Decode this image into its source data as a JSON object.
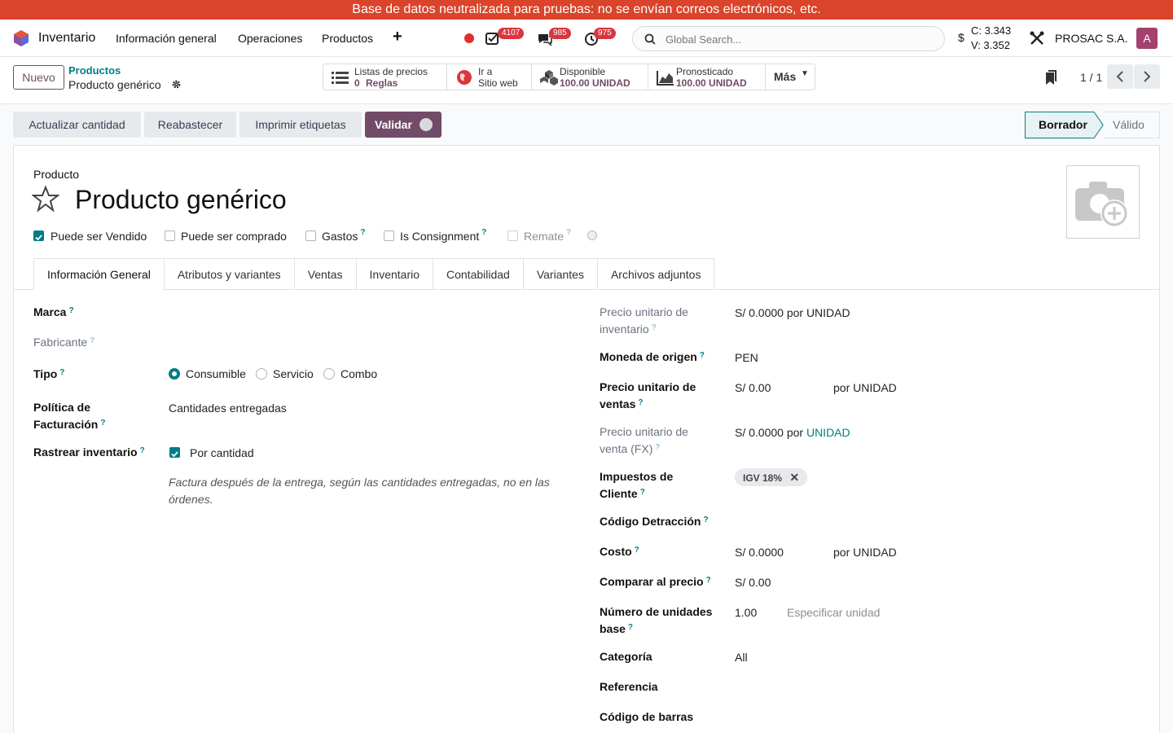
{
  "banner": "Base de datos neutralizada para pruebas: no se envían correos electrónicos, etc.",
  "navbar": {
    "app_name": "Inventario",
    "menu": [
      "Información general",
      "Operaciones",
      "Productos"
    ],
    "badges": {
      "activities": "4107",
      "messages": "985",
      "timers": "975"
    },
    "search_placeholder": "Global Search...",
    "currency_symbol": "$",
    "rate_buy": "C: 3.343",
    "rate_sell": "V: 3.352",
    "company": "PROSAC S.A.",
    "avatar_letter": "A",
    "avatar_color": "#a2426d"
  },
  "control": {
    "new_label": "Nuevo",
    "breadcrumb_parent": "Productos",
    "breadcrumb_current": "Producto genérico",
    "smart_buttons": {
      "pricelists_title": "Listas de precios",
      "pricelists_count": "0",
      "pricelists_unit": "Reglas",
      "website_line1": "Ir a",
      "website_line2": "Sitio web",
      "available_title": "Disponible",
      "available_value": "100.00 UNIDAD",
      "forecast_title": "Pronosticado",
      "forecast_value": "100.00 UNIDAD",
      "more_label": "Más"
    },
    "pager": "1 / 1"
  },
  "actions": {
    "update_qty": "Actualizar cantidad",
    "replenish": "Reabastecer",
    "print_labels": "Imprimir etiquetas",
    "validate": "Validar"
  },
  "status": {
    "draft": "Borrador",
    "valid": "Válido",
    "current": "Borrador"
  },
  "product": {
    "label": "Producto",
    "name": "Producto genérico",
    "checkboxes": {
      "sale_ok": {
        "label": "Puede ser Vendido",
        "checked": true
      },
      "purchase_ok": {
        "label": "Puede ser comprado",
        "checked": false
      },
      "expenses": {
        "label": "Gastos",
        "checked": false
      },
      "consignment": {
        "label": "Is Consignment",
        "checked": false
      },
      "clearance": {
        "label": "Remate",
        "checked": false
      }
    }
  },
  "tabs": [
    "Información General",
    "Atributos y variantes",
    "Ventas",
    "Inventario",
    "Contabilidad",
    "Variantes",
    "Archivos adjuntos"
  ],
  "left_fields": {
    "brand_label": "Marca",
    "manufacturer_label": "Fabricante",
    "type_label": "Tipo",
    "type_options": [
      "Consumible",
      "Servicio",
      "Combo"
    ],
    "type_selected": "Consumible",
    "invoice_policy_label_1": "Política de",
    "invoice_policy_label_2": "Facturación",
    "invoice_policy_value": "Cantidades entregadas",
    "track_inventory_label": "Rastrear inventario",
    "track_inventory_value": "Por cantidad",
    "note_line1": "Factura después de la entrega, según las cantidades entregadas, no en las",
    "note_line2": "órdenes."
  },
  "right_fields": {
    "inv_unit_price_label_1": "Precio unitario de",
    "inv_unit_price_label_2": "inventario",
    "inv_unit_price_value": "S/ 0.0000 por UNIDAD",
    "origin_currency_label": "Moneda de origen",
    "origin_currency_value": "PEN",
    "sale_price_label_1": "Precio unitario de",
    "sale_price_label_2": "ventas",
    "sale_price_value": "S/ 0.00",
    "sale_price_uom": "por UNIDAD",
    "sale_price_fx_label_1": "Precio unitario de",
    "sale_price_fx_label_2": "venta (FX)",
    "sale_price_fx_value": "S/ 0.0000 por",
    "sale_price_fx_uom": "UNIDAD",
    "customer_taxes_label_1": "Impuestos de",
    "customer_taxes_label_2": "Cliente",
    "customer_tax_tag": "IGV 18%",
    "detraction_label": "Código Detracción",
    "cost_label": "Costo",
    "cost_value": "S/ 0.0000",
    "cost_uom": "por UNIDAD",
    "compare_price_label": "Comparar al precio",
    "compare_price_value": "S/ 0.00",
    "base_units_label_1": "Número de unidades",
    "base_units_label_2": "base",
    "base_units_value": "1.00",
    "base_units_placeholder": "Especificar unidad",
    "category_label": "Categoría",
    "category_value": "All",
    "reference_label": "Referencia",
    "barcode_label": "Código de barras"
  },
  "help_marker": "?",
  "colors": {
    "banner": "#d9442b",
    "primary": "#714b67",
    "accent": "#017e84",
    "badge": "#d9363e"
  }
}
